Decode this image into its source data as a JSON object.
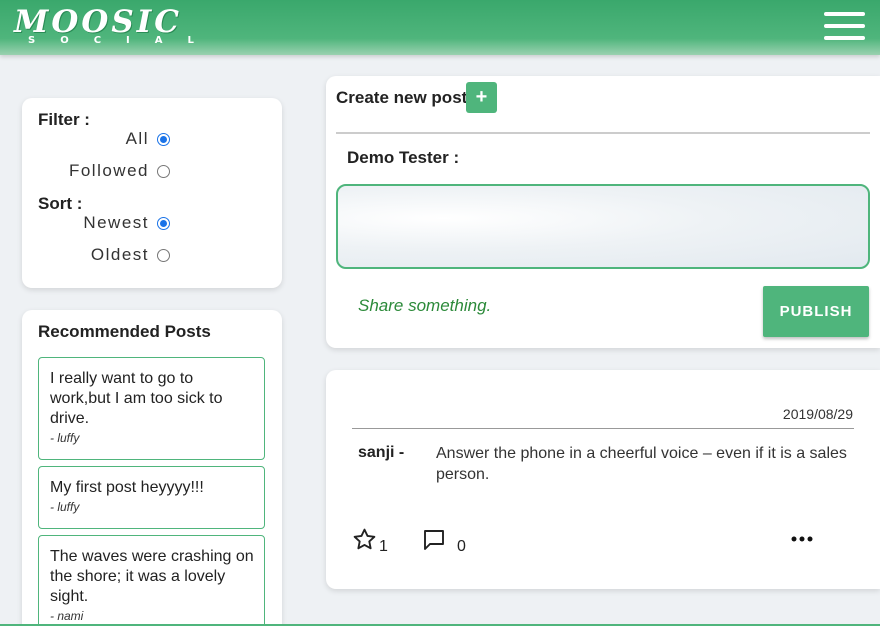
{
  "header": {
    "logo_main": "MOOSIC",
    "logo_sub": "SOCIAL",
    "menu_icon": "hamburger-menu-icon",
    "colors": {
      "header_green": "#3aa86c",
      "accent": "#4fb57c"
    }
  },
  "filter": {
    "filter_label": "Filter :",
    "filter_options": [
      {
        "label": "All",
        "checked": true
      },
      {
        "label": "Followed",
        "checked": false
      }
    ],
    "sort_label": "Sort :",
    "sort_options": [
      {
        "label": "Newest",
        "checked": true
      },
      {
        "label": "Oldest",
        "checked": false
      }
    ]
  },
  "recommended": {
    "title": "Recommended Posts",
    "items": [
      {
        "text": "I really want to go to work,but I am too sick to drive.",
        "author": "- luffy"
      },
      {
        "text": "My first post heyyyy!!!",
        "author": "- luffy"
      },
      {
        "text": "The waves were crashing on the shore; it was a lovely sight.",
        "author": "- nami"
      }
    ]
  },
  "create_post": {
    "title": "Create new post",
    "plus_label": "+",
    "author_label": "Demo Tester :",
    "textarea_value": "",
    "share_hint": "Share something.",
    "publish_label": "PUBLISH"
  },
  "post": {
    "date": "2019/08/29",
    "author": "sanji -",
    "text": "Answer the phone in a cheerful voice – even if it is a sales person.",
    "star_count": "1",
    "comment_count": "0",
    "icons": [
      "star-icon",
      "comment-icon",
      "more-options-icon"
    ]
  }
}
